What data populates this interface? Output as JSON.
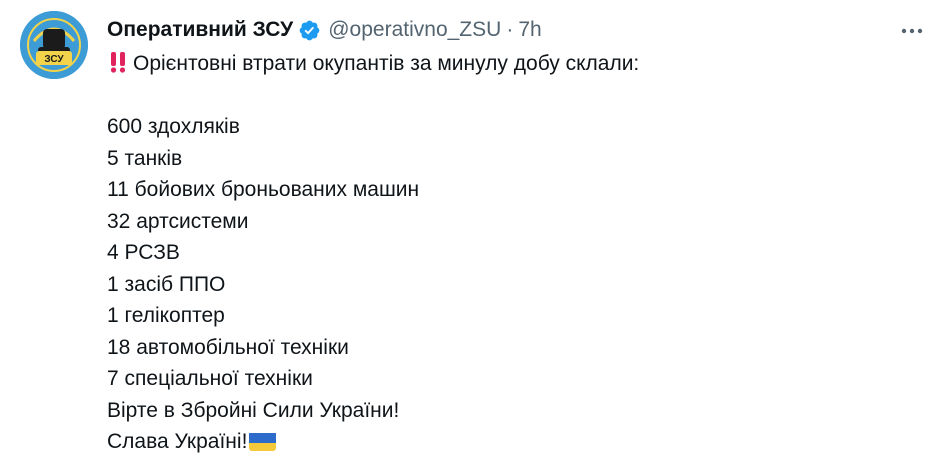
{
  "tweet": {
    "display_name": "Оперативний ЗСУ",
    "handle": "@operativno_ZSU",
    "separator": "·",
    "time": "7h",
    "verified": true,
    "avatar_text": "ЗСУ",
    "headline": "Орієнтовні втрати окупантів за минулу добу склали:",
    "losses": [
      "600 здохляків",
      "5 танків",
      "11 бойових броньованих машин",
      "32 артсистеми",
      "4 РСЗВ",
      "1 засіб ППО",
      "1 гелікоптер",
      "18 автомобільної техніки",
      "7 спеціальної техніки"
    ],
    "closing": [
      "Вірте в Збройні Сили України!",
      "Слава Україні!"
    ],
    "icons": {
      "verified": "verified-badge-icon",
      "more": "more-options-icon",
      "headline_emoji": "double-exclamation-icon",
      "closing_emoji": "ukraine-flag-icon"
    },
    "colors": {
      "name": "#0f1419",
      "muted": "#536471",
      "verified": "#1d9bf0",
      "emoji_red": "#e0245e",
      "flag_blue": "#2e6ccc",
      "flag_yellow": "#f6c93a"
    }
  }
}
